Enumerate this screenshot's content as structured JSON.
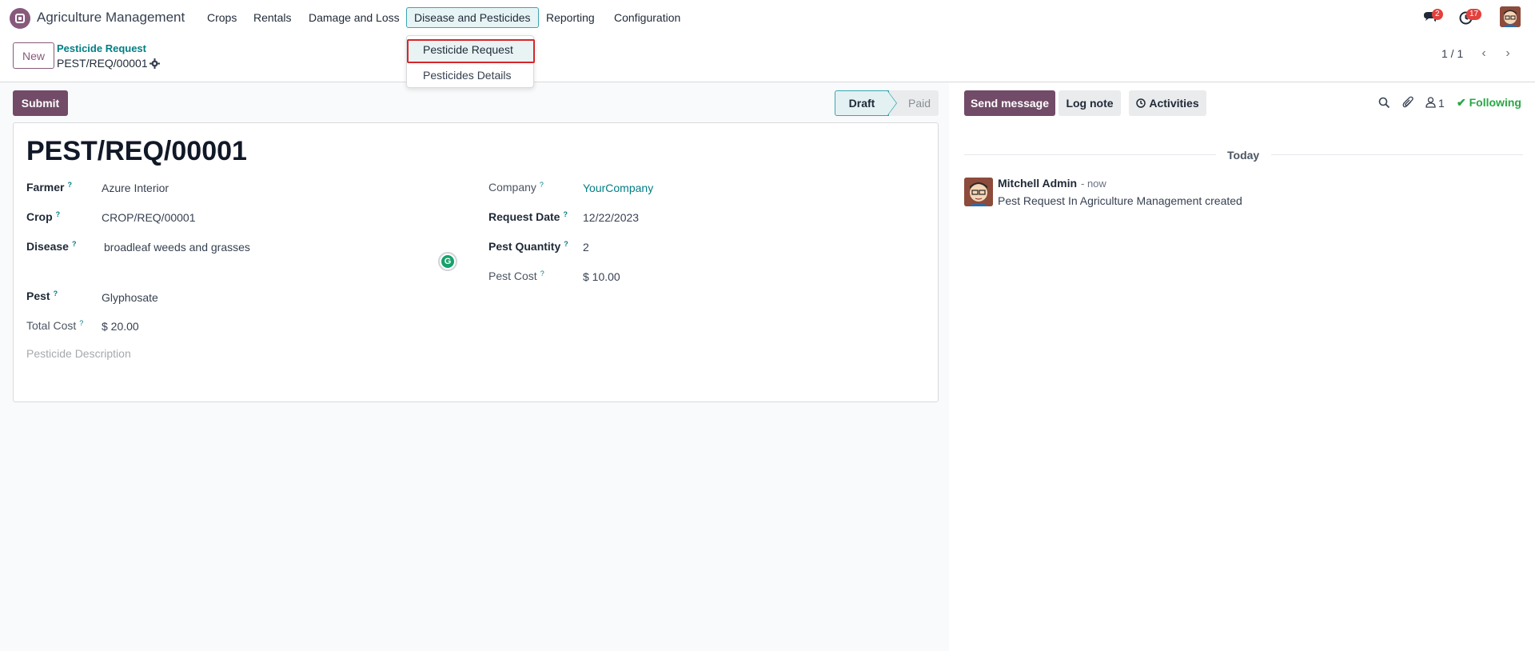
{
  "navbar": {
    "app_name": "Agriculture Management",
    "menu": [
      "Crops",
      "Rentals",
      "Damage and Loss",
      "Disease and Pesticides",
      "Reporting",
      "Configuration"
    ],
    "messages_badge": "2",
    "activities_badge": "17"
  },
  "dropdown": {
    "items": [
      "Pesticide Request",
      "Pesticides Details"
    ]
  },
  "control": {
    "new_label": "New",
    "breadcrumb": "Pesticide Request",
    "record_name": "PEST/REQ/00001",
    "pager": "1 / 1"
  },
  "statusbar": {
    "submit_label": "Submit",
    "stages": [
      "Draft",
      "Paid"
    ],
    "current": "Draft"
  },
  "form": {
    "title": "PEST/REQ/00001",
    "farmer_label": "Farmer",
    "farmer": "Azure Interior",
    "crop_label": "Crop",
    "crop": "CROP/REQ/00001",
    "disease_label": "Disease",
    "disease": "broadleaf weeds and grasses",
    "pest_label": "Pest",
    "pest": "Glyphosate",
    "total_cost_label": "Total Cost",
    "total_cost": "$ 20.00",
    "company_label": "Company",
    "company": "YourCompany",
    "request_date_label": "Request Date",
    "request_date": "12/22/2023",
    "pest_quantity_label": "Pest Quantity",
    "pest_quantity": "2",
    "pest_cost_label": "Pest Cost",
    "pest_cost": "$ 10.00",
    "description_placeholder": "Pesticide Description",
    "help_mark": "?"
  },
  "chatter": {
    "send_message": "Send message",
    "log_note": "Log note",
    "activities": "Activities",
    "followers_count": "1",
    "following": "Following",
    "date_separator": "Today",
    "message": {
      "author": "Mitchell Admin",
      "time": "- now",
      "body": "Pest Request In Agriculture Management created"
    }
  }
}
